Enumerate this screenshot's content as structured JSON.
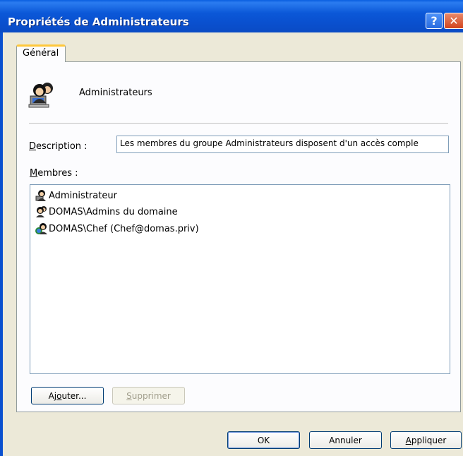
{
  "window": {
    "title": "Propriétés de Administrateurs",
    "help_label": "?",
    "close_label": "✕"
  },
  "tabs": [
    {
      "label": "Général",
      "selected": true
    }
  ],
  "group": {
    "name": "Administrateurs",
    "icon": "group-icon"
  },
  "description": {
    "label_prefix": "D",
    "label_rest": "escription :",
    "value": "Les membres du groupe Administrateurs disposent d'un accès comple"
  },
  "members": {
    "label_prefix": "M",
    "label_rest": "embres :",
    "items": [
      {
        "name": "Administrateur",
        "icon": "user-icon"
      },
      {
        "name": "DOMAS\\Admins du domaine",
        "icon": "group-icon"
      },
      {
        "name": "DOMAS\\Chef (Chef@domas.priv)",
        "icon": "domain-user-icon"
      }
    ]
  },
  "buttons": {
    "add_prefix": "Aj",
    "add_underline": "o",
    "add_rest": "uter...",
    "remove_underline": "S",
    "remove_rest": "upprimer",
    "ok": "OK",
    "cancel": "Annuler",
    "apply_underline": "A",
    "apply_rest": "ppliquer"
  },
  "colors": {
    "titlebar": "#0a50cf",
    "dialog_bg": "#ece9d8",
    "tab_accent": "#ffc83c",
    "close_button": "#d2431d"
  }
}
